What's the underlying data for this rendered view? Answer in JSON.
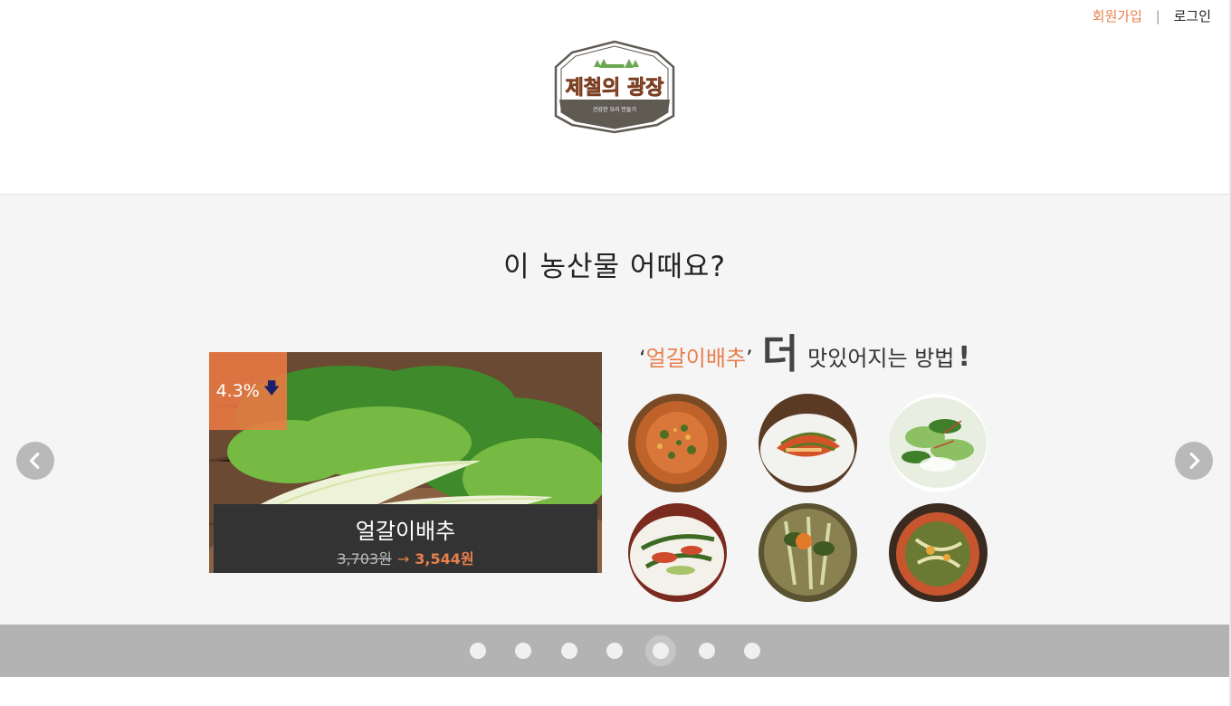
{
  "header": {
    "signup_label": "회원가입",
    "separator": "|",
    "login_label": "로그인",
    "logo": {
      "title": "제철의 광장",
      "tagline": "건강한 요리 만들기"
    }
  },
  "main": {
    "section_title": "이 농산물 어때요?",
    "product": {
      "discount": "4.3%",
      "name": "얼갈이배추",
      "old_price": "3,703원",
      "arrow": "→",
      "new_price": "3,544원"
    },
    "recipes": {
      "quote_open": "‘",
      "highlight": "얼갈이배추",
      "quote_close": "’",
      "big_word": "더",
      "rest": "맛있어지는 방법",
      "bang": "!",
      "thumbnails": [
        "recipe-1",
        "recipe-2",
        "recipe-3",
        "recipe-4",
        "recipe-5",
        "recipe-6"
      ]
    },
    "nav": {
      "prev_icon": "chevron-left-icon",
      "next_icon": "chevron-right-icon"
    }
  },
  "pager": {
    "dot_count": 7,
    "active_index": 4
  },
  "colors": {
    "accent": "#e8804d",
    "caption_bg": "#333333",
    "pager_bg": "#b3b3b3",
    "main_bg": "#f5f5f5"
  }
}
